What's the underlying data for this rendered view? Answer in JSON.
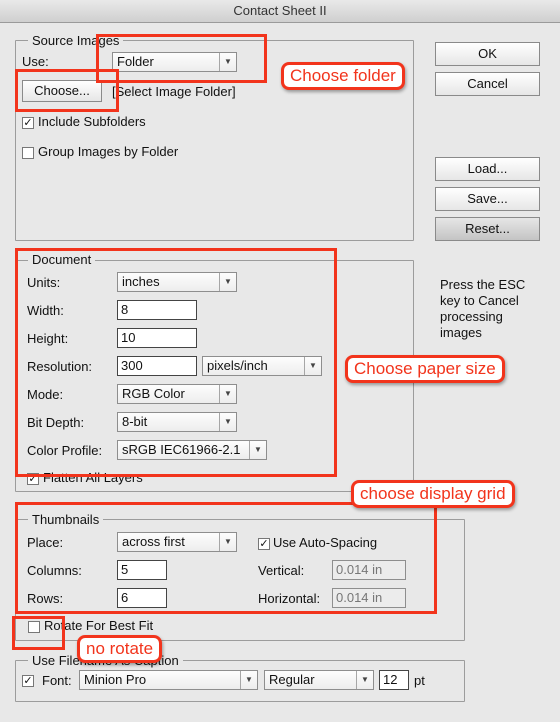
{
  "window": {
    "title": "Contact Sheet II"
  },
  "source_images": {
    "legend": "Source Images",
    "use_label": "Use:",
    "use_value": "Folder",
    "choose_button": "Choose...",
    "folder_path": "[Select Image Folder]",
    "include_subfolders": {
      "label": "Include Subfolders",
      "checked": true
    },
    "group_by_folder": {
      "label": "Group Images by Folder",
      "checked": false
    }
  },
  "buttons": {
    "ok": "OK",
    "cancel": "Cancel",
    "load": "Load...",
    "save": "Save...",
    "reset": "Reset..."
  },
  "esc_note": [
    "Press the ESC",
    "key to Cancel",
    "processing",
    "images"
  ],
  "document": {
    "legend": "Document",
    "units_label": "Units:",
    "units_value": "inches",
    "width_label": "Width:",
    "width_value": "8",
    "height_label": "Height:",
    "height_value": "10",
    "resolution_label": "Resolution:",
    "resolution_value": "300",
    "resolution_unit": "pixels/inch",
    "mode_label": "Mode:",
    "mode_value": "RGB Color",
    "bit_depth_label": "Bit Depth:",
    "bit_depth_value": "8-bit",
    "color_profile_label": "Color Profile:",
    "color_profile_value": "sRGB IEC61966-2.1",
    "flatten": {
      "label": "Flatten All Layers",
      "checked": true
    }
  },
  "thumbnails": {
    "legend": "Thumbnails",
    "place_label": "Place:",
    "place_value": "across first",
    "columns_label": "Columns:",
    "columns_value": "5",
    "rows_label": "Rows:",
    "rows_value": "6",
    "auto_spacing": {
      "label": "Use Auto-Spacing",
      "checked": true
    },
    "vertical_label": "Vertical:",
    "vertical_value": "0.014 in",
    "horizontal_label": "Horizontal:",
    "horizontal_value": "0.014 in",
    "rotate": {
      "label": "Rotate For Best Fit",
      "checked": false
    }
  },
  "caption": {
    "legend": "Use Filename As Caption",
    "font_checked": true,
    "font_label": "Font:",
    "font_value": "Minion Pro",
    "style_value": "Regular",
    "size_value": "12",
    "size_unit": "pt"
  },
  "annotations": {
    "choose_folder": "Choose folder",
    "choose_paper_size": "Choose paper size",
    "choose_display_grid": "choose display grid",
    "no_rotate": "no rotate",
    "color": "#f2341c"
  }
}
